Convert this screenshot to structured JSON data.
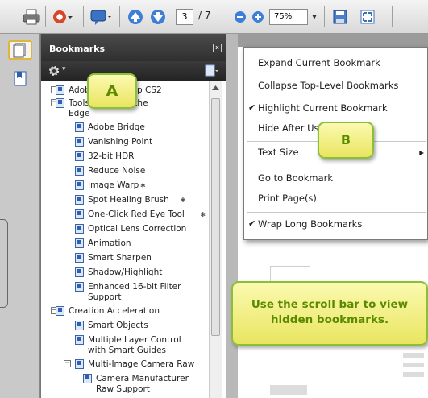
{
  "toolbar": {
    "current_page": "3",
    "page_total": "/ 7",
    "zoom": "75%",
    "zoom_arrow": "▾",
    "icons": [
      "print-icon",
      "create-pdf-icon",
      "comment-icon",
      "previous-page-icon",
      "next-page-icon",
      "zoom-out-icon",
      "zoom-in-icon",
      "save-icon",
      "fit-page-icon"
    ]
  },
  "bookmarks_panel": {
    "title": "Bookmarks",
    "close": "x",
    "options_arrow": "▾",
    "items": [
      {
        "label": "Adobe Photoshop CS2",
        "level": 0,
        "expander": ""
      },
      {
        "label": "Tools to Create the",
        "label2": "Edge",
        "level": 0,
        "expander": "−"
      },
      {
        "label": "Adobe Bridge",
        "level": 1
      },
      {
        "label": "Vanishing Point",
        "level": 1
      },
      {
        "label": "32-bit HDR",
        "level": 1
      },
      {
        "label": "Reduce Noise",
        "level": 1
      },
      {
        "label": "Image Warp",
        "level": 1,
        "mark": "✱"
      },
      {
        "label": "Spot Healing Brush",
        "level": 1,
        "mark": "✱"
      },
      {
        "label": "One-Click Red Eye Tool",
        "level": 1,
        "mark": "✱"
      },
      {
        "label": "Optical Lens Correction",
        "level": 1
      },
      {
        "label": "Animation",
        "level": 1
      },
      {
        "label": "Smart Sharpen",
        "level": 1
      },
      {
        "label": "Shadow/Highlight",
        "level": 1
      },
      {
        "label": "Enhanced 16-bit Filter",
        "label2": "Support",
        "level": 1
      },
      {
        "label": "Creation Acceleration",
        "level": 0,
        "expander": "−"
      },
      {
        "label": "Smart Objects",
        "level": 1
      },
      {
        "label": "Multiple Layer Control",
        "label2": "with Smart Guides",
        "level": 1
      },
      {
        "label": "Multi-Image Camera Raw",
        "level": 1,
        "expander": "−"
      },
      {
        "label": "Camera Manufacturer",
        "label2": "Raw Support",
        "level": 2
      }
    ]
  },
  "context_menu": {
    "items": [
      {
        "label": "Expand Current Bookmark",
        "checked": false
      },
      {
        "label": "Collapse Top-Level Bookmarks",
        "checked": false
      },
      {
        "label": "Highlight Current Bookmark",
        "checked": true
      },
      {
        "label": "Hide After Use",
        "checked": false
      },
      {
        "label": "Text Size",
        "checked": false,
        "submenu": "▸"
      },
      {
        "label": "Go to Bookmark",
        "checked": false
      },
      {
        "label": "Print Page(s)",
        "checked": false
      },
      {
        "label": "Wrap Long Bookmarks",
        "checked": true
      }
    ],
    "check_glyph": "✔"
  },
  "callouts": {
    "a": "A",
    "b": "B",
    "scroll_line1": "Use the scroll bar to view",
    "scroll_line2": "hidden bookmarks."
  },
  "colors": {
    "callout_border": "#8bbf3a",
    "callout_text": "#5b8a00",
    "panel_header": "#3a3a3a",
    "bookmark_icon": "#2e5fb0"
  }
}
